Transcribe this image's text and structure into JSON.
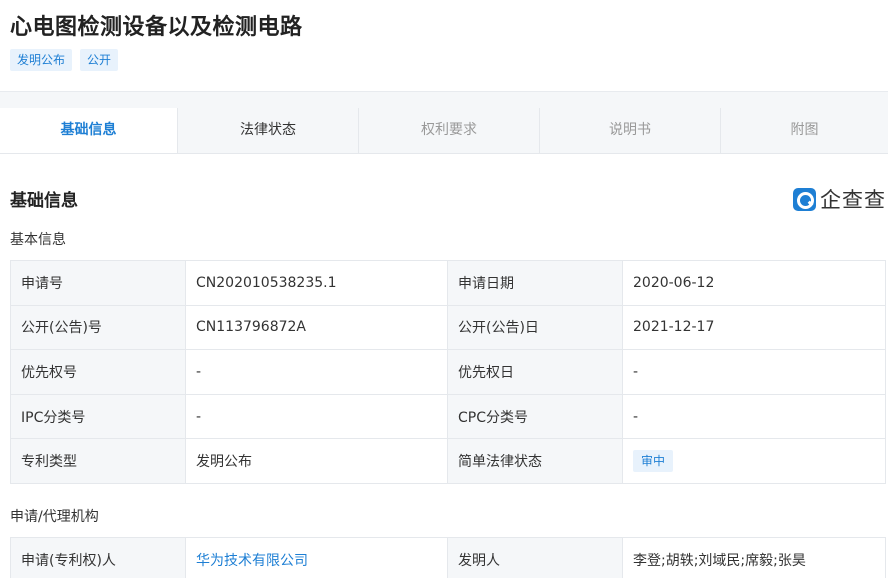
{
  "patent": {
    "title": "心电图检测设备以及检测电路",
    "tags": [
      "发明公布",
      "公开"
    ]
  },
  "tabs": [
    {
      "label": "基础信息"
    },
    {
      "label": "法律状态"
    },
    {
      "label": "权利要求"
    },
    {
      "label": "说明书"
    },
    {
      "label": "附图"
    }
  ],
  "section": {
    "title": "基础信息",
    "logo_text": "企查查"
  },
  "basic_info": {
    "title": "基本信息",
    "rows": [
      {
        "l1": "申请号",
        "v1": "CN202010538235.1",
        "l2": "申请日期",
        "v2": "2020-06-12"
      },
      {
        "l1": "公开(公告)号",
        "v1": "CN113796872A",
        "l2": "公开(公告)日",
        "v2": "2021-12-17"
      },
      {
        "l1": "优先权号",
        "v1": "-",
        "l2": "优先权日",
        "v2": "-"
      },
      {
        "l1": "IPC分类号",
        "v1": "-",
        "l2": "CPC分类号",
        "v2": "-"
      },
      {
        "l1": "专利类型",
        "v1": "发明公布",
        "l2": "简单法律状态",
        "v2": "审中"
      }
    ]
  },
  "agency": {
    "title": "申请/代理机构",
    "rows": [
      {
        "l1": "申请(专利权)人",
        "v1": "华为技术有限公司",
        "l2": "发明人",
        "v2": "李登;胡轶;刘域民;席毅;张昊"
      }
    ]
  }
}
